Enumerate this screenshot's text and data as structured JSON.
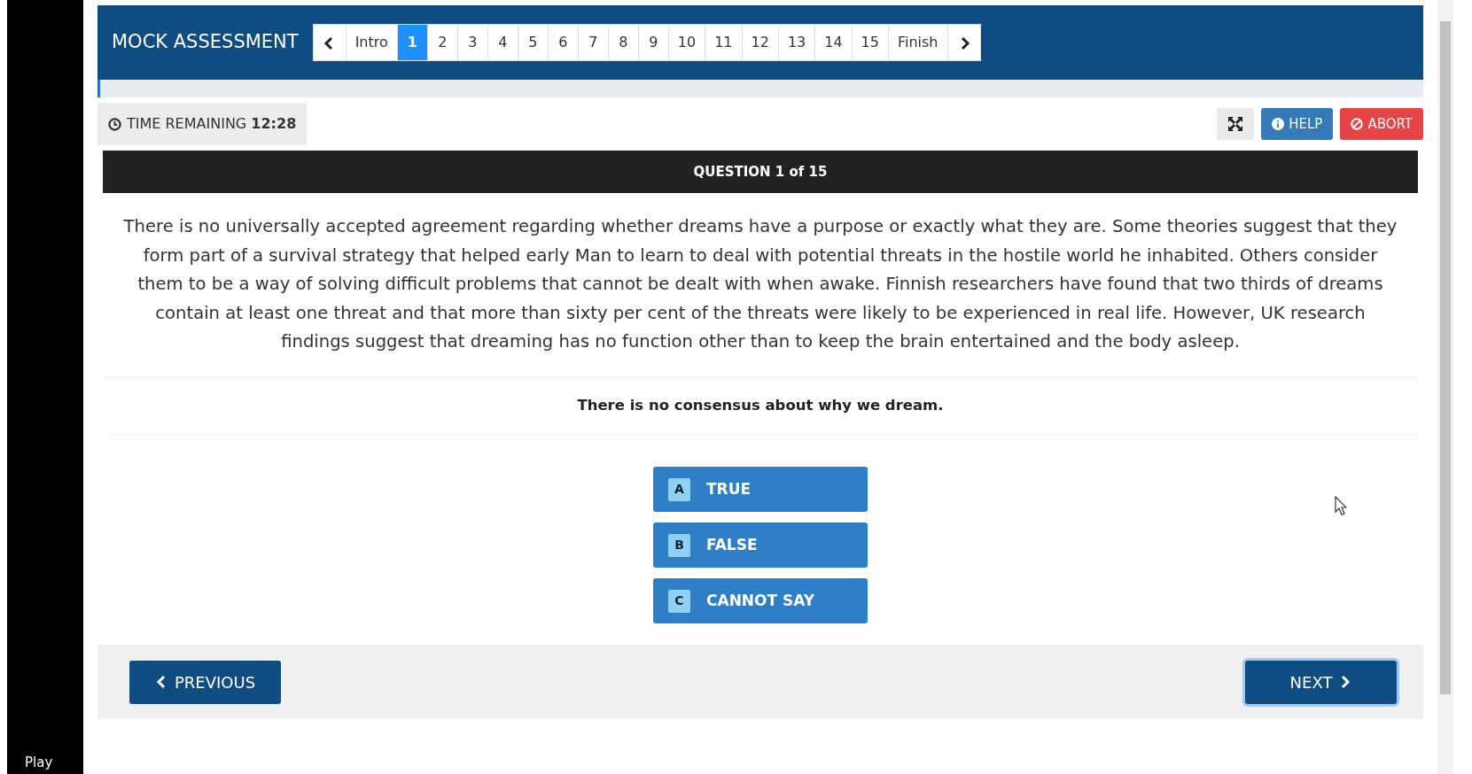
{
  "header": {
    "title": "MOCK ASSESSMENT",
    "pages": [
      {
        "label": "Intro",
        "selected": false
      },
      {
        "label": "1",
        "selected": true
      },
      {
        "label": "2",
        "selected": false
      },
      {
        "label": "3",
        "selected": false
      },
      {
        "label": "4",
        "selected": false
      },
      {
        "label": "5",
        "selected": false
      },
      {
        "label": "6",
        "selected": false
      },
      {
        "label": "7",
        "selected": false
      },
      {
        "label": "8",
        "selected": false
      },
      {
        "label": "9",
        "selected": false
      },
      {
        "label": "10",
        "selected": false
      },
      {
        "label": "11",
        "selected": false
      },
      {
        "label": "12",
        "selected": false
      },
      {
        "label": "13",
        "selected": false
      },
      {
        "label": "14",
        "selected": false
      },
      {
        "label": "15",
        "selected": false
      },
      {
        "label": "Finish",
        "selected": false
      }
    ]
  },
  "progress": {
    "level": 0.002
  },
  "timer": {
    "label": "TIME REMAINING",
    "value": "12:28"
  },
  "toolbar": {
    "help": "HELP",
    "abort": "ABORT"
  },
  "question": {
    "heading": "QUESTION 1 of 15",
    "passage": "There is no universally accepted agreement regarding whether dreams have a purpose or exactly what they are. Some theories suggest that they form part of a survival strategy that helped early Man to learn to deal with potential threats in the hostile world he inhabited. Others consider them to be a way of solving difficult problems that cannot be dealt with when awake. Finnish researchers have found that two thirds of dreams contain at least one threat and that more than sixty per cent of the threats were likely to be experienced in real life. However, UK research findings suggest that dreaming has no function other than to keep the brain entertained and the body asleep.",
    "statement": "There is no consensus about why we dream.",
    "options": [
      {
        "letter": "A",
        "label": "TRUE"
      },
      {
        "letter": "B",
        "label": "FALSE"
      },
      {
        "letter": "C",
        "label": "CANNOT SAY"
      }
    ]
  },
  "footer": {
    "previous": "PREVIOUS",
    "next": "NEXT"
  },
  "player": {
    "label": "Play"
  }
}
